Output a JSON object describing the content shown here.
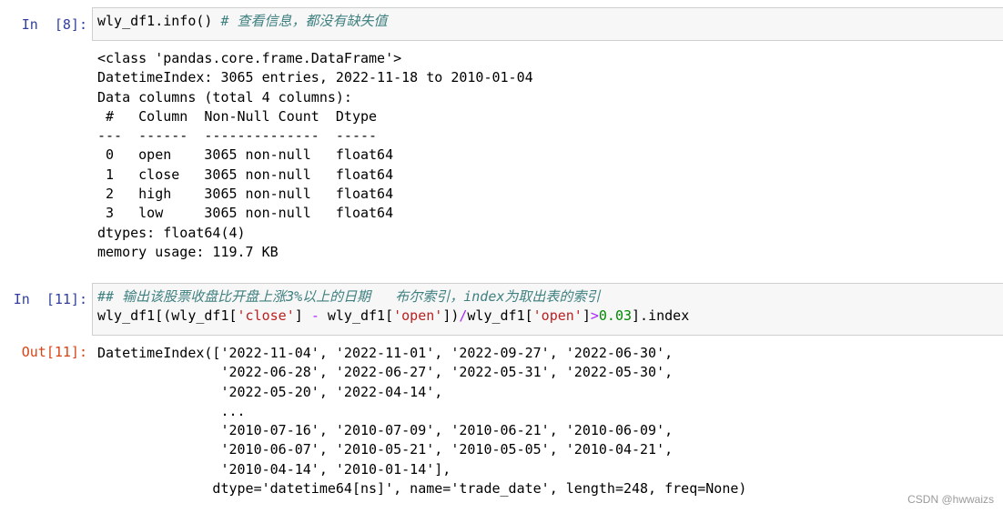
{
  "cells": [
    {
      "prompt": "In  [8]:",
      "code_call": "wly_df1.info() ",
      "code_comment": "# 查看信息，都没有缺失值",
      "output_lines": [
        "<class 'pandas.core.frame.DataFrame'>",
        "DatetimeIndex: 3065 entries, 2022-11-18 to 2010-01-04",
        "Data columns (total 4 columns):",
        " #   Column  Non-Null Count  Dtype  ",
        "---  ------  --------------  -----  ",
        " 0   open    3065 non-null   float64",
        " 1   close   3065 non-null   float64",
        " 2   high    3065 non-null   float64",
        " 3   low     3065 non-null   float64",
        "dtypes: float64(4)",
        "memory usage: 119.7 KB"
      ]
    },
    {
      "prompt": "In  [11]:",
      "comment": "## 输出该股票收盘比开盘上涨3%以上的日期   布尔索引，index为取出表的索引",
      "code": {
        "p1": "wly_df1[(wly_df1[",
        "s1": "'close'",
        "p2": "] ",
        "op1": "-",
        "p3": " wly_df1[",
        "s2": "'open'",
        "p4": "])",
        "op2": "/",
        "p5": "wly_df1[",
        "s3": "'open'",
        "p6": "]",
        "op3": ">",
        "num": "0.03",
        "p7": "].index"
      }
    },
    {
      "prompt": "Out[11]:",
      "output_lines": [
        "DatetimeIndex(['2022-11-04', '2022-11-01', '2022-09-27', '2022-06-30',",
        "               '2022-06-28', '2022-06-27', '2022-05-31', '2022-05-30',",
        "               '2022-05-20', '2022-04-14',",
        "               ...",
        "               '2010-07-16', '2010-07-09', '2010-06-21', '2010-06-09',",
        "               '2010-06-07', '2010-05-21', '2010-05-05', '2010-04-21',",
        "               '2010-04-14', '2010-01-14'],",
        "              dtype='datetime64[ns]', name='trade_date', length=248, freq=None)"
      ]
    }
  ],
  "watermark": "CSDN @hwwaizs",
  "colors": {
    "prompt_in": "#303F9F",
    "prompt_out": "#D84315",
    "comment": "#408080",
    "string": "#BA2121",
    "number": "#008800",
    "operator": "#AA22FF",
    "input_bg": "#f7f7f7",
    "input_border": "#cfcfcf"
  }
}
